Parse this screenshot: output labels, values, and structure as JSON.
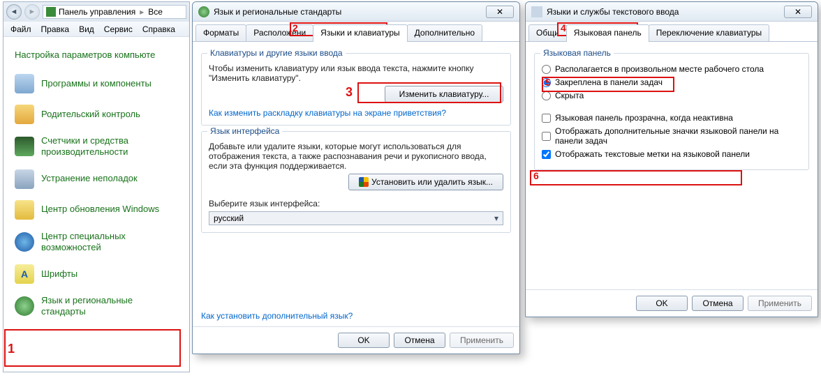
{
  "control_panel": {
    "address": {
      "root": "Панель управления",
      "crumb": "Все"
    },
    "menubar": [
      "Файл",
      "Правка",
      "Вид",
      "Сервис",
      "Справка"
    ],
    "heading": "Настройка параметров компьюте",
    "items": [
      {
        "label": "Программы и компоненты"
      },
      {
        "label": "Родительский контроль"
      },
      {
        "label": "Счетчики и средства производительности"
      },
      {
        "label": "Устранение неполадок"
      },
      {
        "label": "Центр обновления Windows"
      },
      {
        "label": "Центр специальных возможностей"
      },
      {
        "label": "Шрифты"
      },
      {
        "label": "Язык и региональные стандарты"
      }
    ]
  },
  "dialog1": {
    "title": "Язык и региональные стандарты",
    "tabs": [
      "Форматы",
      "Расположени",
      "Языки и клавиатуры",
      "Дополнительно"
    ],
    "grp1": {
      "legend": "Клавиатуры и другие языки ввода",
      "desc": "Чтобы изменить клавиатуру или язык ввода текста, нажмите кнопку \"Изменить клавиатуру\".",
      "btn": "Изменить клавиатуру...",
      "link": "Как изменить раскладку клавиатуры на экране приветствия?"
    },
    "grp2": {
      "legend": "Язык интерфейса",
      "desc": "Добавьте или удалите языки, которые могут использоваться для отображения текста, а также распознавания речи и рукописного ввода, если эта функция поддерживается.",
      "btn": "Установить или удалить язык...",
      "select_label": "Выберите язык интерфейса:",
      "select_value": "русский"
    },
    "bottom_link": "Как установить дополнительный язык?",
    "buttons": {
      "ok": "OK",
      "cancel": "Отмена",
      "apply": "Применить"
    }
  },
  "dialog2": {
    "title": "Языки и службы текстового ввода",
    "tabs": [
      "Общи",
      "Языковая панель",
      "Переключение клавиатуры"
    ],
    "grp": {
      "legend": "Языковая панель",
      "radios": {
        "r1": "Располагается в произвольном месте рабочего стола",
        "r2": "Закреплена в панели задач",
        "r3": "Скрыта"
      },
      "chk1": "Языковая панель прозрачна, когда неактивна",
      "chk2": "Отображать дополнительные значки языковой панели на панели задач",
      "chk3": "Отображать текстовые метки на языковой панели"
    },
    "buttons": {
      "ok": "OK",
      "cancel": "Отмена",
      "apply": "Применить"
    }
  },
  "callouts": {
    "1": "1",
    "2": "2",
    "3": "3",
    "4": "4",
    "5": "5",
    "6": "6"
  }
}
